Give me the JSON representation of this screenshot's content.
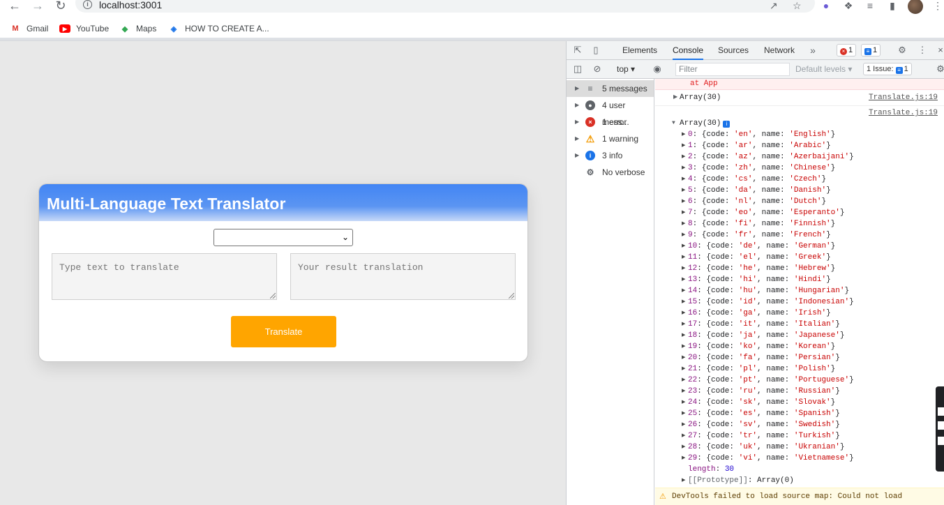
{
  "browser": {
    "url": "localhost:3001",
    "bookmarks": [
      {
        "label": "Gmail",
        "icon": "gmail-icon"
      },
      {
        "label": "YouTube",
        "icon": "youtube-icon"
      },
      {
        "label": "Maps",
        "icon": "maps-icon"
      },
      {
        "label": "HOW TO CREATE A...",
        "icon": "layers-icon"
      }
    ]
  },
  "app": {
    "title": "Multi-Language Text Translator",
    "source_placeholder": "Type text to translate",
    "result_placeholder": "Your result translation",
    "translate_label": "Translate",
    "colors": {
      "header": "#4285f4",
      "button": "#ffa500"
    }
  },
  "devtools": {
    "tabs": [
      "Elements",
      "Console",
      "Sources",
      "Network"
    ],
    "active_tab": "Console",
    "error_count": "1",
    "message_count": "1",
    "context": "top",
    "filter_placeholder": "Filter",
    "levels_label": "Default levels",
    "issues_label": "1 Issue:",
    "issues_count": "1",
    "sidebar": [
      {
        "label": "5 messages",
        "icon": "list-icon"
      },
      {
        "label": "4 user mess...",
        "icon": "user-icon"
      },
      {
        "label": "1 error",
        "icon": "error-icon"
      },
      {
        "label": "1 warning",
        "icon": "warning-icon"
      },
      {
        "label": "3 info",
        "icon": "info-icon"
      },
      {
        "label": "No verbose",
        "icon": "bug-icon"
      }
    ],
    "console": {
      "error_tail": "at App",
      "collapsed_array": "Array(30)",
      "expanded_array": "Array(30)",
      "source": "Translate.js:19",
      "languages": [
        {
          "code": "en",
          "name": "English"
        },
        {
          "code": "ar",
          "name": "Arabic"
        },
        {
          "code": "az",
          "name": "Azerbaijani"
        },
        {
          "code": "zh",
          "name": "Chinese"
        },
        {
          "code": "cs",
          "name": "Czech"
        },
        {
          "code": "da",
          "name": "Danish"
        },
        {
          "code": "nl",
          "name": "Dutch"
        },
        {
          "code": "eo",
          "name": "Esperanto"
        },
        {
          "code": "fi",
          "name": "Finnish"
        },
        {
          "code": "fr",
          "name": "French"
        },
        {
          "code": "de",
          "name": "German"
        },
        {
          "code": "el",
          "name": "Greek"
        },
        {
          "code": "he",
          "name": "Hebrew"
        },
        {
          "code": "hi",
          "name": "Hindi"
        },
        {
          "code": "hu",
          "name": "Hungarian"
        },
        {
          "code": "id",
          "name": "Indonesian"
        },
        {
          "code": "ga",
          "name": "Irish"
        },
        {
          "code": "it",
          "name": "Italian"
        },
        {
          "code": "ja",
          "name": "Japanese"
        },
        {
          "code": "ko",
          "name": "Korean"
        },
        {
          "code": "fa",
          "name": "Persian"
        },
        {
          "code": "pl",
          "name": "Polish"
        },
        {
          "code": "pt",
          "name": "Portuguese"
        },
        {
          "code": "ru",
          "name": "Russian"
        },
        {
          "code": "sk",
          "name": "Slovak"
        },
        {
          "code": "es",
          "name": "Spanish"
        },
        {
          "code": "sv",
          "name": "Swedish"
        },
        {
          "code": "tr",
          "name": "Turkish"
        },
        {
          "code": "uk",
          "name": "Ukranian"
        },
        {
          "code": "vi",
          "name": "Vietnamese"
        }
      ],
      "length_label": "length",
      "length_value": "30",
      "prototype_label": "[[Prototype]]",
      "prototype_value": "Array(0)",
      "warning": "DevTools failed to load source map: Could not load"
    }
  }
}
